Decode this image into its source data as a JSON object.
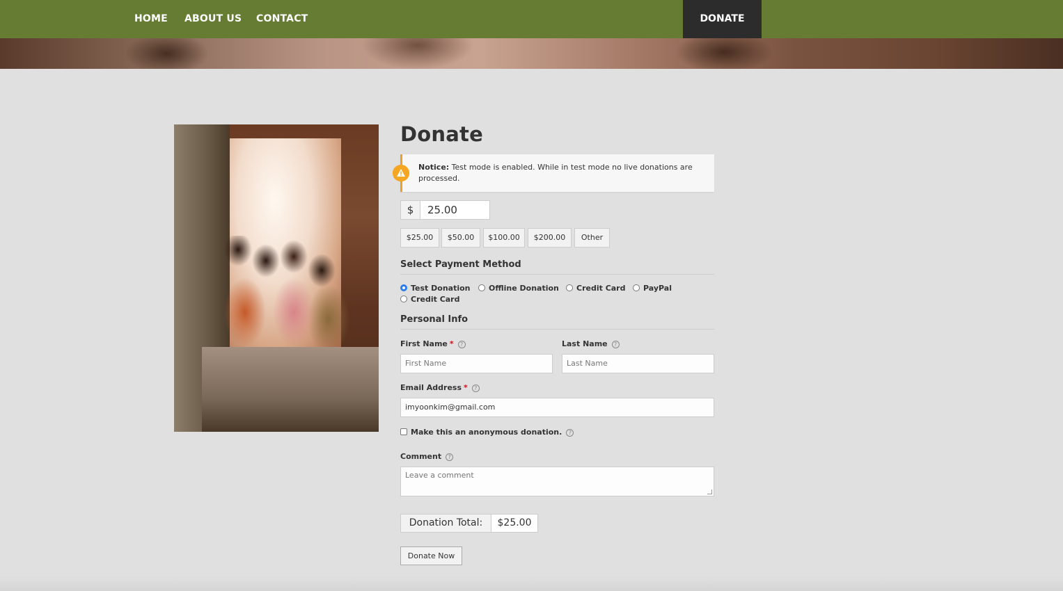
{
  "nav": {
    "links": [
      "HOME",
      "ABOUT US",
      "CONTACT"
    ],
    "donate": "DONATE"
  },
  "form": {
    "title": "Donate",
    "notice": {
      "bold": "Notice:",
      "text": "Test mode is enabled. While in test mode no live donations are processed."
    },
    "currency_symbol": "$",
    "amount": "25.00",
    "levels": [
      "$25.00",
      "$50.00",
      "$100.00",
      "$200.00",
      "Other"
    ],
    "payment": {
      "heading": "Select Payment Method",
      "options": [
        "Test Donation",
        "Offline Donation",
        "Credit Card",
        "PayPal",
        "Credit Card"
      ],
      "selected": "Test Donation"
    },
    "personal": {
      "heading": "Personal Info",
      "first_name_label": "First Name",
      "first_name_placeholder": "First Name",
      "last_name_label": "Last Name",
      "last_name_placeholder": "Last Name",
      "email_label": "Email Address",
      "email_value": "imyoonkim@gmail.com",
      "required_mark": "*",
      "anonymous_label": "Make this an anonymous donation.",
      "comment_label": "Comment",
      "comment_placeholder": "Leave a comment"
    },
    "total_label": "Donation Total:",
    "total_value": "$25.00",
    "submit": "Donate Now"
  },
  "icons": {
    "help": "?",
    "warning": "!"
  },
  "colors": {
    "nav_bg": "#657c32",
    "donate_bg": "#2c2c2c",
    "notice_accent": "#f0a02a",
    "radio_selected": "#2b7de9",
    "required": "#c0131f"
  }
}
